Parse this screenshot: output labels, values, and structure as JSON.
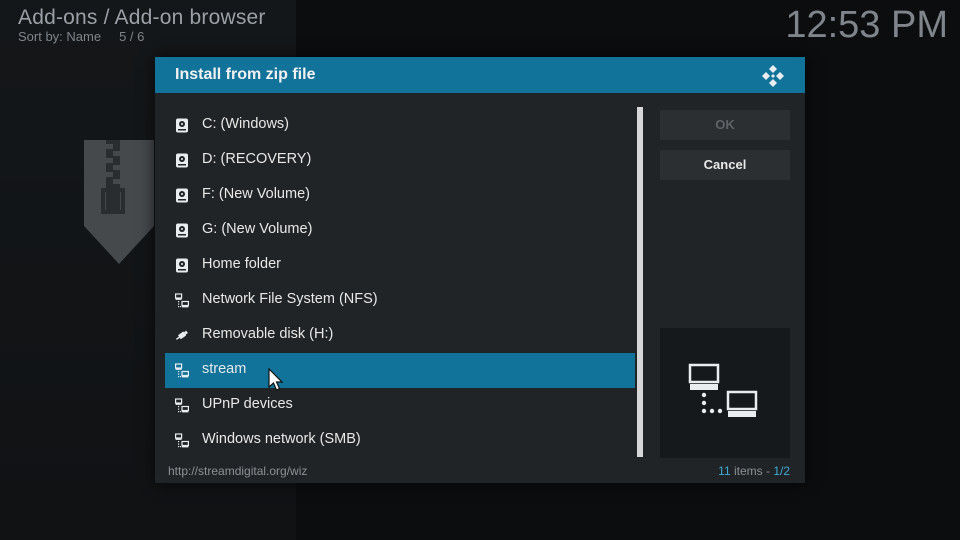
{
  "header": {
    "path": "Add-ons / Add-on browser",
    "sort_label": "Sort by: Name",
    "count": "5 / 6",
    "clock": "12:53 PM"
  },
  "dialog": {
    "title": "Install from zip file",
    "logo_icon": "kodi-logo-icon",
    "items": [
      {
        "label": "C: (Windows)",
        "icon": "hard-drive-icon"
      },
      {
        "label": "D: (RECOVERY)",
        "icon": "hard-drive-icon"
      },
      {
        "label": "F: (New Volume)",
        "icon": "hard-drive-icon"
      },
      {
        "label": "G: (New Volume)",
        "icon": "hard-drive-icon"
      },
      {
        "label": "Home folder",
        "icon": "hard-drive-icon"
      },
      {
        "label": "Network File System (NFS)",
        "icon": "network-icon"
      },
      {
        "label": "Removable disk (H:)",
        "icon": "usb-icon"
      },
      {
        "label": "stream",
        "icon": "network-icon",
        "selected": true
      },
      {
        "label": "UPnP devices",
        "icon": "network-icon"
      },
      {
        "label": "Windows network (SMB)",
        "icon": "network-icon"
      }
    ],
    "ok_label": "OK",
    "cancel_label": "Cancel",
    "status_path": "http://streamdigital.org/wiz",
    "items_count": "11",
    "items_word": " items - ",
    "page": "1/2",
    "preview_icon": "network-icon"
  },
  "colors": {
    "accent": "#12739a",
    "dialog_bg": "#212426",
    "button_bg": "#2b2f31",
    "highlight_text": "#3da9d6"
  }
}
